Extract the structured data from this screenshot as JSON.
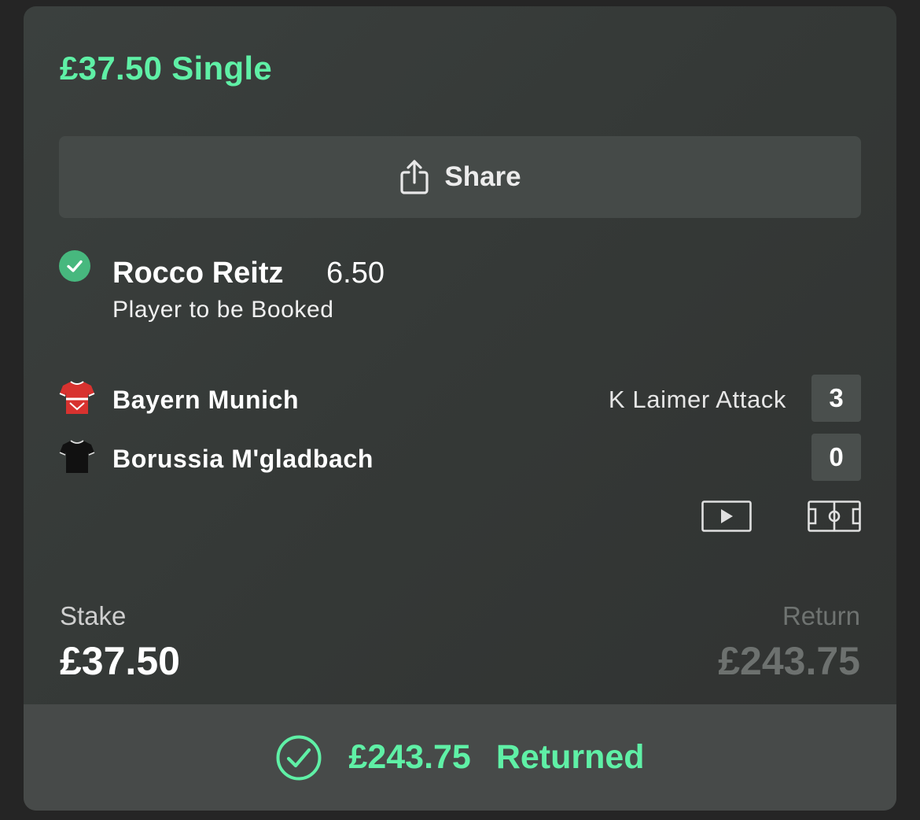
{
  "bet": {
    "title": "£37.50 Single"
  },
  "share": {
    "label": "Share",
    "icon": "share-icon"
  },
  "selection": {
    "name": "Rocco Reitz",
    "odds": "6.50",
    "market": "Player to be Booked",
    "status_icon": "check-circle-icon",
    "status": "won"
  },
  "match": {
    "home": {
      "team": "Bayern Munich",
      "score": "3",
      "event": "K Laimer Attack",
      "kit_icon": "red-shirt-icon"
    },
    "away": {
      "team": "Borussia M'gladbach",
      "score": "0",
      "kit_icon": "black-shirt-icon"
    },
    "actions": [
      "video-play-icon",
      "pitch-icon"
    ]
  },
  "summary": {
    "stake_label": "Stake",
    "stake_value": "£37.50",
    "return_label": "Return",
    "return_value": "£243.75"
  },
  "footer": {
    "amount": "£243.75",
    "status": "Returned",
    "icon": "check-circle-outline-icon"
  },
  "colors": {
    "accent_green": "#5ff0a6",
    "check_green": "#47b87e",
    "card_bg": "#373b39",
    "footer_bg": "#474a49"
  }
}
